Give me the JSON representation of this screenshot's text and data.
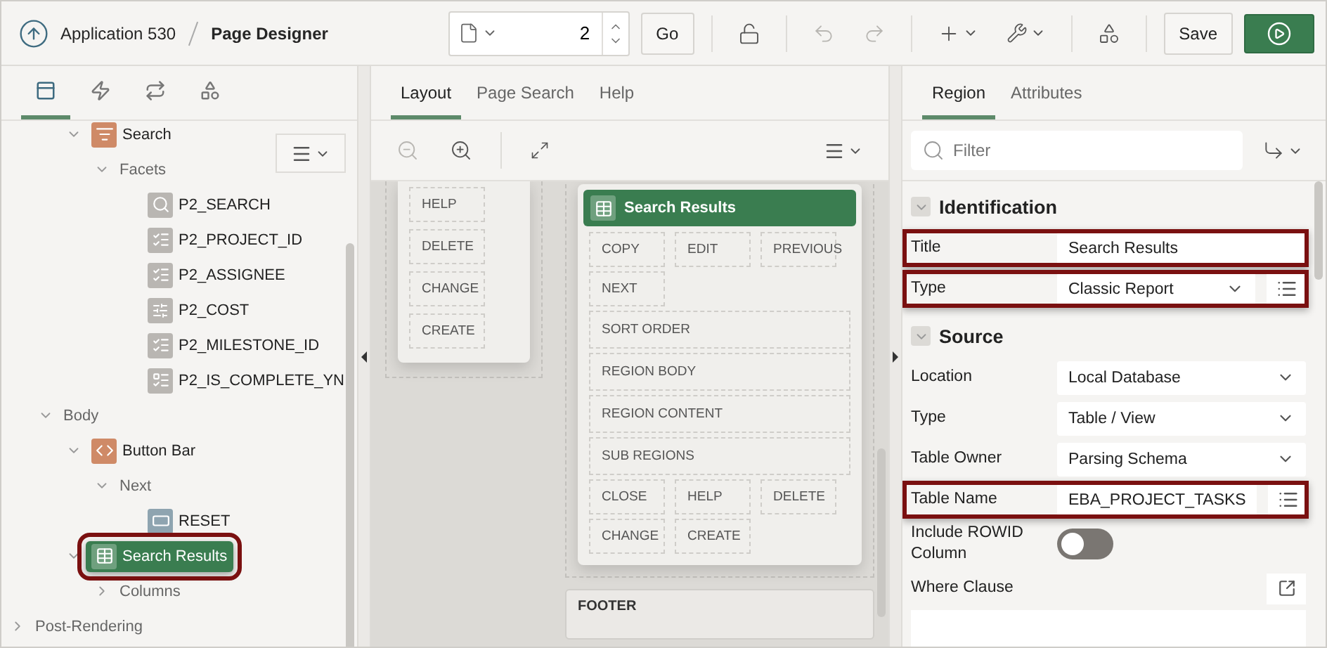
{
  "header": {
    "app_title": "Application 530",
    "page_title": "Page Designer",
    "page_number": "2",
    "go_button": "Go",
    "save_button": "Save"
  },
  "left_tabs": [
    {
      "selected": true
    },
    {
      "selected": false
    },
    {
      "selected": false
    },
    {
      "selected": false
    }
  ],
  "tree": [
    {
      "children": [
        {
          "children": [
            {
              "label": "Search",
              "kind": "search-region",
              "expanded": true,
              "selected": false,
              "children": [
                {
                  "label": "Facets",
                  "expanded": true,
                  "selected": false,
                  "children": [
                    {
                      "label": "P2_SEARCH",
                      "kind": "facet-search",
                      "selected": false
                    },
                    {
                      "label": "P2_PROJECT_ID",
                      "kind": "facet-checkbox",
                      "selected": false
                    },
                    {
                      "label": "P2_ASSIGNEE",
                      "kind": "facet-checkbox",
                      "selected": false
                    },
                    {
                      "label": "P2_COST",
                      "kind": "facet-range",
                      "selected": false
                    },
                    {
                      "label": "P2_MILESTONE_ID",
                      "kind": "facet-checkbox",
                      "selected": false
                    },
                    {
                      "label": "P2_IS_COMPLETE_YN",
                      "kind": "facet-radio",
                      "selected": false
                    }
                  ]
                }
              ]
            }
          ]
        },
        {
          "label": "Body",
          "expanded": true,
          "selected": false,
          "children": [
            {
              "label": "Button Bar",
              "kind": "static-region",
              "expanded": true,
              "selected": false,
              "children": [
                {
                  "label": "Next",
                  "expanded": true,
                  "selected": false,
                  "children": [
                    {
                      "label": "RESET",
                      "kind": "button",
                      "selected": false
                    }
                  ]
                }
              ]
            },
            {
              "label": "Search Results",
              "kind": "report",
              "expanded": true,
              "selected": true,
              "highlighted": true,
              "children": [
                {
                  "label": "Columns",
                  "expanded": false,
                  "selected": false
                }
              ]
            }
          ]
        }
      ]
    },
    {
      "label": "Post-Rendering",
      "expanded": false,
      "selected": false
    }
  ],
  "center_tabs": [
    {
      "label": "Layout",
      "selected": true
    },
    {
      "label": "Page Search",
      "selected": false
    },
    {
      "label": "Help",
      "selected": false
    }
  ],
  "canvas": {
    "left_card_buttons": [
      "HELP",
      "DELETE",
      "CHANGE",
      "CREATE"
    ],
    "region_title": "Search Results",
    "slots": [
      {
        "label": "COPY",
        "kind": "button"
      },
      {
        "label": "EDIT",
        "kind": "button"
      },
      {
        "label": "PREVIOUS",
        "kind": "button"
      },
      {
        "label": "NEXT",
        "kind": "button"
      },
      {
        "label": "SORT ORDER",
        "kind": "position"
      },
      {
        "label": "REGION BODY",
        "kind": "position"
      },
      {
        "label": "REGION CONTENT",
        "kind": "position"
      },
      {
        "label": "SUB REGIONS",
        "kind": "position"
      },
      {
        "label": "CLOSE",
        "kind": "button"
      },
      {
        "label": "HELP",
        "kind": "button"
      },
      {
        "label": "DELETE",
        "kind": "button"
      },
      {
        "label": "CHANGE",
        "kind": "button"
      },
      {
        "label": "CREATE",
        "kind": "button"
      }
    ],
    "footer": "FOOTER"
  },
  "right_tabs": [
    {
      "label": "Region",
      "selected": true
    },
    {
      "label": "Attributes",
      "selected": false
    }
  ],
  "filter": {
    "placeholder": "Filter"
  },
  "groups": [
    {
      "title": "Identification",
      "expanded": true,
      "rows": [
        {
          "label": "Title",
          "kind": "text",
          "value": "Search Results",
          "highlighted": true
        },
        {
          "label": "Type",
          "kind": "select",
          "value": "Classic Report",
          "list_button": true,
          "highlighted": true
        }
      ]
    },
    {
      "title": "Source",
      "expanded": true,
      "rows": [
        {
          "label": "Location",
          "kind": "select",
          "value": "Local Database"
        },
        {
          "label": "Type",
          "kind": "select",
          "value": "Table / View"
        },
        {
          "label": "Table Owner",
          "kind": "select",
          "value": "Parsing Schema"
        },
        {
          "label": "Table Name",
          "kind": "text",
          "value": "EBA_PROJECT_TASKS",
          "list_button": true,
          "highlighted": true
        },
        {
          "label": "Include ROWID Column",
          "kind": "switch",
          "on": false
        },
        {
          "label": "Where Clause",
          "kind": "code"
        }
      ]
    }
  ]
}
